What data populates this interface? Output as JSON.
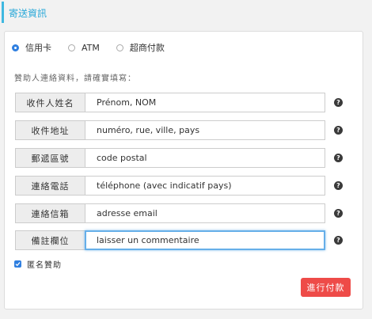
{
  "header": {
    "title": "寄送資訊"
  },
  "payment": {
    "options": [
      {
        "label": "信用卡",
        "checked": true
      },
      {
        "label": "ATM",
        "checked": false
      },
      {
        "label": "超商付款",
        "checked": false
      }
    ]
  },
  "note": "贊助人連絡資料，請確實填寫：",
  "fields": [
    {
      "label": "收件人姓名",
      "value": "Prénom, NOM"
    },
    {
      "label": "收件地址",
      "value": "numéro, rue, ville, pays"
    },
    {
      "label": "郵遞區號",
      "value": "code postal"
    },
    {
      "label": "連絡電話",
      "value": "téléphone (avec indicatif pays)"
    },
    {
      "label": "連絡信箱",
      "value": "adresse email"
    },
    {
      "label": "備註欄位",
      "value": "laisser un commentaire"
    }
  ],
  "help_symbol": "?",
  "anonymous": {
    "label": "匿名贊助",
    "checked": true
  },
  "submit": {
    "label": "進行付款"
  },
  "colors": {
    "accent": "#3fb8e0",
    "radio": "#2f7fe0",
    "submit": "#ee4b48"
  }
}
